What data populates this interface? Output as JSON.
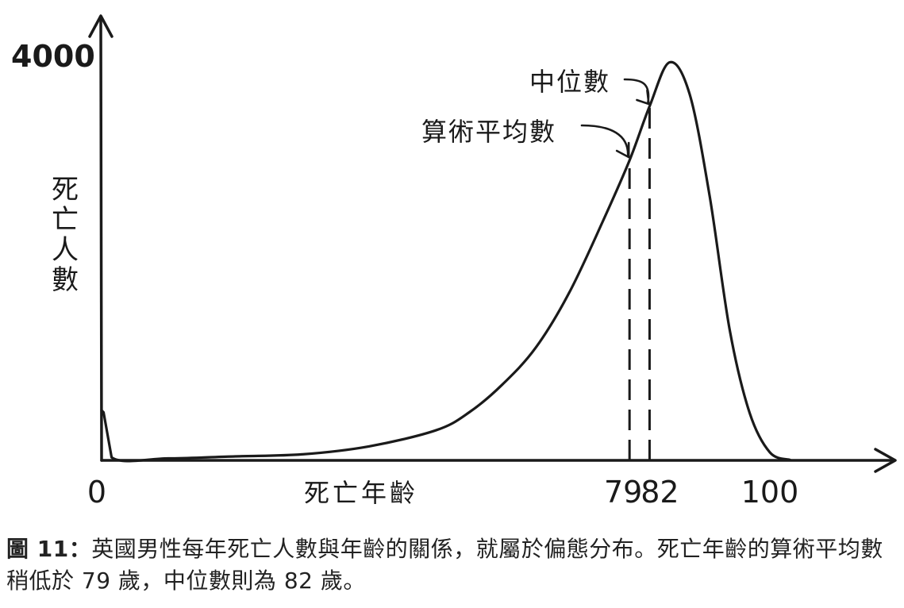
{
  "chart_data": {
    "type": "line",
    "ylabel": "死亡人數",
    "xlabel": "死亡年齡",
    "y_tick_labels": [
      "4000"
    ],
    "x_tick_labels": [
      "0",
      "79",
      "82",
      "100"
    ],
    "xlim": [
      0,
      108
    ],
    "ylim": [
      0,
      4000
    ],
    "series": [
      {
        "x": [
          0,
          0.3,
          1.5,
          10,
          20,
          30,
          40,
          50,
          55,
          60,
          65,
          70,
          75,
          79,
          82,
          85,
          88,
          91,
          94,
          97,
          100,
          103
        ],
        "y": [
          500,
          480,
          30,
          20,
          40,
          60,
          140,
          300,
          480,
          760,
          1130,
          1680,
          2390,
          3000,
          3540,
          3980,
          3660,
          2640,
          1300,
          470,
          80,
          5
        ]
      }
    ],
    "annotations": [
      {
        "text": "算術平均數",
        "x": 79
      },
      {
        "text": "中位數",
        "x": 82
      }
    ]
  },
  "caption": {
    "label": "圖 11：",
    "text": "英國男性每年死亡人數與年齡的關係，就屬於偏態分布。死亡年齡的算術平均數稍低於 79 歲，中位數則為 82 歲。"
  },
  "colors": {
    "ink": "#1a1a1a",
    "background": "#ffffff"
  }
}
